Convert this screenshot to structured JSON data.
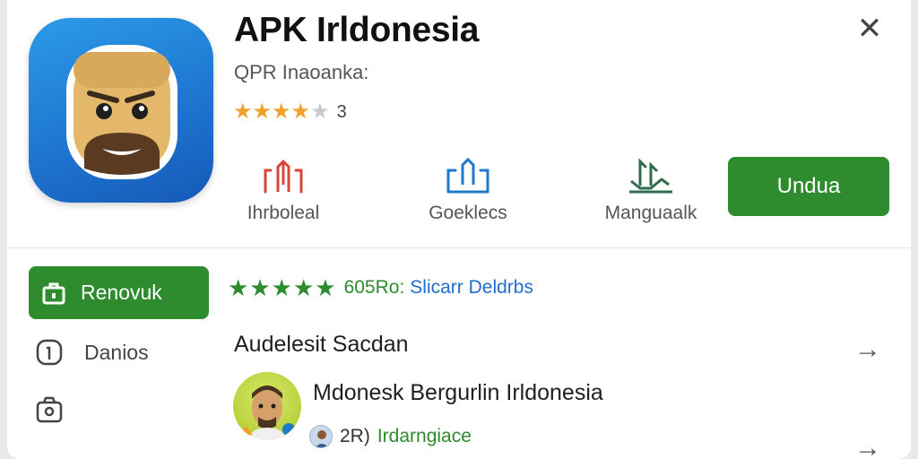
{
  "header": {
    "title": "APK Irldonesia",
    "subtitle": "QPR Inaoanka:",
    "rating_count": "3",
    "stars": [
      "full",
      "full",
      "full",
      "full",
      "half"
    ],
    "close_glyph": "✕"
  },
  "stats": [
    {
      "label": "Ihrboleal",
      "icon": "download-count-icon",
      "color": "#d8453b"
    },
    {
      "label": "Goeklecs",
      "icon": "upload-arrows-icon",
      "color": "#1f78c8"
    },
    {
      "label": "Manguaalk",
      "icon": "install-arrows-icon",
      "color": "#2f6b4c"
    }
  ],
  "download_button": {
    "label": "Undua"
  },
  "sidebar": {
    "renew_label": "Renovuk",
    "items": [
      {
        "label": "Danios",
        "icon": "info-icon"
      },
      {
        "label": "",
        "icon": "camera-icon"
      }
    ]
  },
  "review": {
    "star_count": 5,
    "score": "605Ro:",
    "link": "Slicarr Deldrbs"
  },
  "section": {
    "title": "Audelesit Sacdan"
  },
  "developer": {
    "name": "Mdonesk Bergurlin Irldonesia",
    "count": "2R)",
    "tag": "Irdarngiace"
  },
  "colors": {
    "accent_green": "#2e8b2e",
    "icon_blue": "#1d73cf",
    "star_orange": "#f3a02a",
    "link_blue": "#1f6fcf"
  }
}
